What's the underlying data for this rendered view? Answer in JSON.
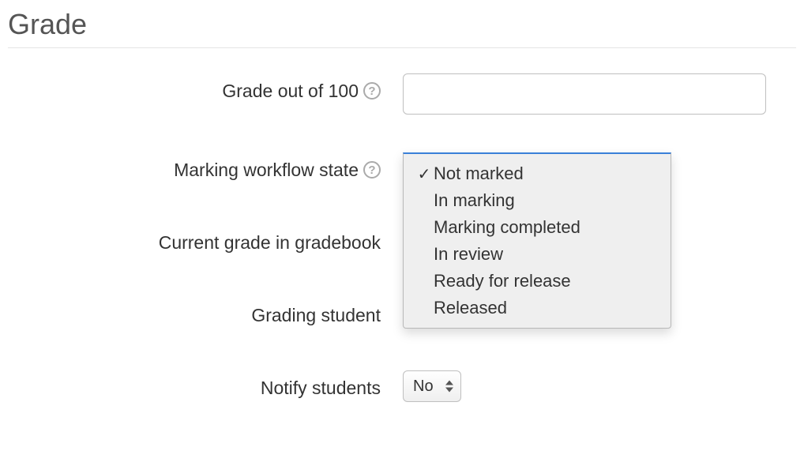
{
  "section": {
    "title": "Grade"
  },
  "rows": {
    "grade_out": {
      "label": "Grade out of 100",
      "value": ""
    },
    "workflow": {
      "label": "Marking workflow state"
    },
    "current_grade": {
      "label": "Current grade in gradebook"
    },
    "grading_student": {
      "label": "Grading student"
    },
    "notify": {
      "label": "Notify students",
      "value": "No"
    }
  },
  "workflow_options": [
    {
      "label": "Not marked",
      "selected": true
    },
    {
      "label": "In marking",
      "selected": false
    },
    {
      "label": "Marking completed",
      "selected": false
    },
    {
      "label": "In review",
      "selected": false
    },
    {
      "label": "Ready for release",
      "selected": false
    },
    {
      "label": "Released",
      "selected": false
    }
  ]
}
